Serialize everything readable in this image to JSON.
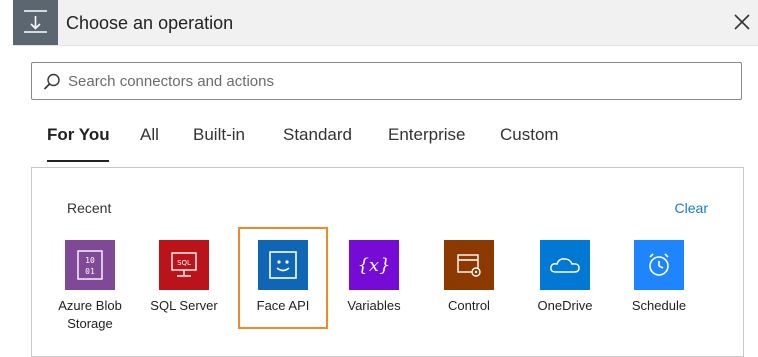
{
  "header": {
    "title": "Choose an operation"
  },
  "search": {
    "placeholder": "Search connectors and actions"
  },
  "tabs": [
    {
      "label": "For You"
    },
    {
      "label": "All"
    },
    {
      "label": "Built-in"
    },
    {
      "label": "Standard"
    },
    {
      "label": "Enterprise"
    },
    {
      "label": "Custom"
    }
  ],
  "recent": {
    "heading": "Recent",
    "clear_label": "Clear",
    "items": [
      {
        "label": "Azure Blob Storage",
        "icon": "blob-storage-icon",
        "color": "#804998"
      },
      {
        "label": "SQL Server",
        "icon": "sql-server-icon",
        "color": "#ba141a"
      },
      {
        "label": "Face API",
        "icon": "face-icon",
        "color": "#0f66b5"
      },
      {
        "label": "Variables",
        "icon": "variables-icon",
        "color": "#770bd6"
      },
      {
        "label": "Control",
        "icon": "control-icon",
        "color": "#8c3900"
      },
      {
        "label": "OneDrive",
        "icon": "onedrive-icon",
        "color": "#0078d4"
      },
      {
        "label": "Schedule",
        "icon": "schedule-icon",
        "color": "#1f85ff"
      }
    ]
  },
  "colors": {
    "accent": "#1a7ac6",
    "highlight": "#ee8a2b",
    "header_bg": "#f1f1f1",
    "header_icon_bg": "#5b6670"
  }
}
